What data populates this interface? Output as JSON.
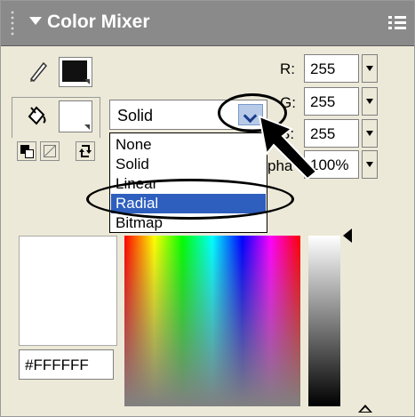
{
  "panel": {
    "title": "Color Mixer",
    "icons": {
      "grip": "grip-dots-icon",
      "collapse": "collapse-arrow-icon",
      "menu": "panel-options-icon",
      "stroke": "pencil-icon",
      "fill": "paint-bucket-icon"
    }
  },
  "rgb": {
    "r_label": "R:",
    "r_value": "255",
    "g_label": "G:",
    "g_value": "255",
    "b_label": "B:",
    "b_value": "255",
    "alpha_label": "pha",
    "alpha_value": "100%"
  },
  "fill_type": {
    "selected": "Solid",
    "options": [
      "None",
      "Solid",
      "Linear",
      "Radial",
      "Bitmap"
    ],
    "highlighted": "Radial"
  },
  "colors": {
    "stroke_color": "#111111",
    "fill_color": "#FFFFFF",
    "hex_value": "#FFFFFF",
    "highlight": "#2e5fbf",
    "panel_bg": "#ece9d8",
    "titlebar_bg": "#8a8a8a"
  },
  "annotations": {
    "callouts": [
      "dropdown-button-ellipse",
      "radial-option-ellipse",
      "pointer-arrow"
    ]
  }
}
